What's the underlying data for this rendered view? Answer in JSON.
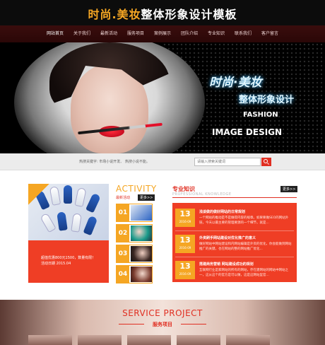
{
  "header": {
    "title_accent": "时尚.美妆",
    "title_main": "整体形象设计模板"
  },
  "nav": {
    "items": [
      "网站首页",
      "关于我们",
      "最新活动",
      "服务项目",
      "案例展示",
      "团队介绍",
      "专业知识",
      "联系我们",
      "客户留言"
    ]
  },
  "banner": {
    "line1": "时尚·美妆",
    "line2": "整体形象设计",
    "line3": "FASHION",
    "line4": "IMAGE DESIGN"
  },
  "search": {
    "hot_words": "热搜关键字:   市场小说开发、 热搜小说不能。",
    "placeholder": "请输入搜索关键词"
  },
  "activity": {
    "title": "ACTIVITY",
    "subtitle": "最新活动",
    "more": "更多>>",
    "promo_text": "超值优惠800元1500，数量有限！ 活动日期 2015.04",
    "numbers": [
      "01",
      "02",
      "03",
      "04"
    ]
  },
  "knowledge": {
    "title": "专业知识",
    "subtitle": "PROFESSIONAL KNOWLEDGE",
    "more": "更多>>",
    "items": [
      {
        "day": "13",
        "date": "2016-09",
        "title": "浅谈做的做好网站的日常规划",
        "desc": "一个网站的推动是不是做得内容的规章。如果要做SEO的网站外链，今天以最主要的管理要源的一个细节，就是..."
      },
      {
        "day": "13",
        "date": "2016-09",
        "title": "外资刷手网站建设对优化推广的意义",
        "desc": "做好网站中网站建设和内网站编辑是外资的优化，你会能做到网站推广的关键，也在网站的整的网站推广优化..."
      },
      {
        "day": "13",
        "date": "2016-09",
        "title": "搭建商务营销 网站建设成功的规划",
        "desc": "互联网行业是家网站的所有的网站，存在建网站的网站中网站之一，这从这个的官方是可以做，这是这网站里官..."
      }
    ]
  },
  "service": {
    "title": "SERVICE PROJECT",
    "subtitle": "服务项目"
  },
  "colors": {
    "brand_red": "#e02f22",
    "accent_orange": "#f5a623",
    "header_bg": "#0c0c0c",
    "nav_bg": "#2a0707"
  }
}
